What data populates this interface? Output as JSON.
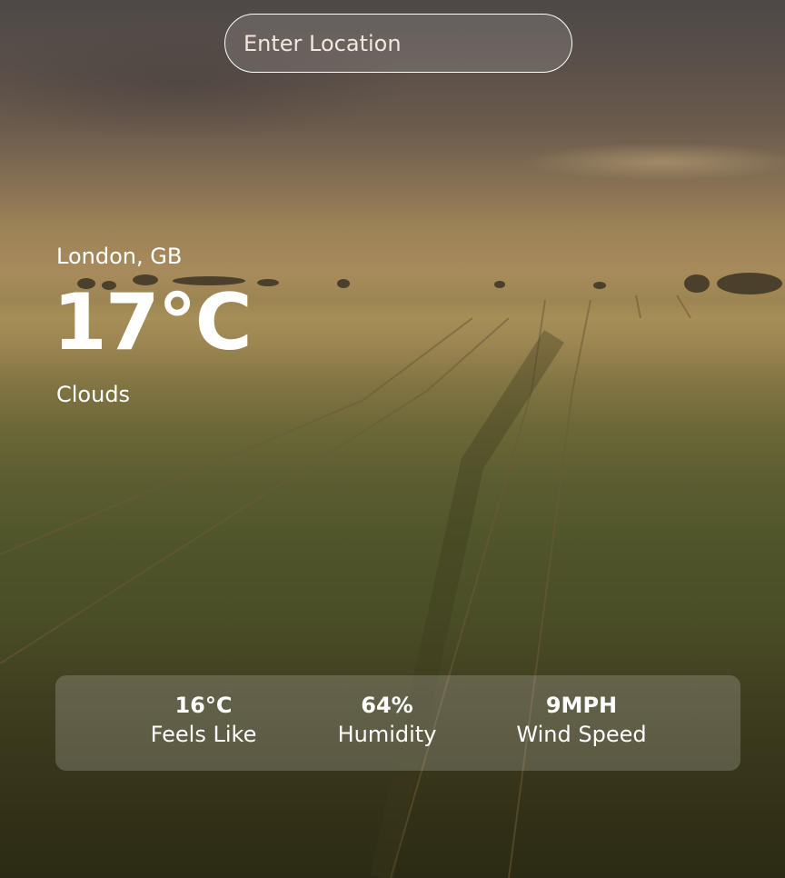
{
  "search": {
    "placeholder": "Enter Location",
    "icon": "text-cursor"
  },
  "current": {
    "location": "London, GB",
    "temperature": "17°C",
    "condition": "Clouds"
  },
  "details": {
    "feels_like": {
      "value": "16°C",
      "label": "Feels Like"
    },
    "humidity": {
      "value": "64%",
      "label": "Humidity"
    },
    "wind_speed": {
      "value": "9MPH",
      "label": "Wind Speed"
    }
  },
  "colors": {
    "text": "#ffffff",
    "placeholder": "#f3e7da",
    "panel": "rgba(255,255,255,0.18)"
  }
}
